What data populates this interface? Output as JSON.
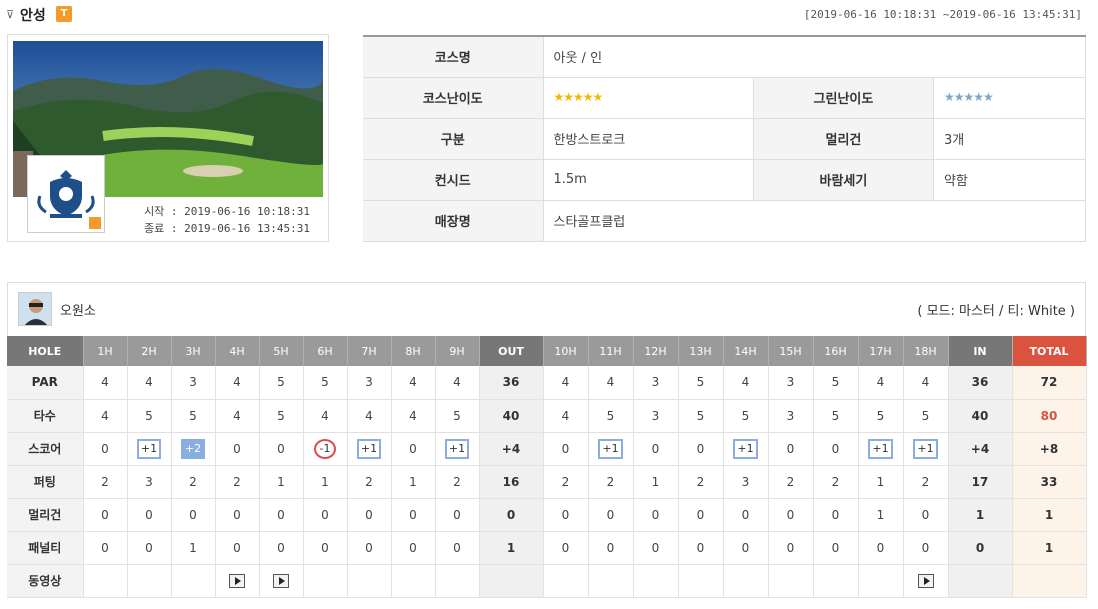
{
  "header": {
    "title": "안성",
    "badge": "T",
    "date_range": "[2019-06-16 10:18:31 ~2019-06-16 13:45:31]"
  },
  "photo": {
    "start_time": "시작 : 2019-06-16 10:18:31",
    "end_time": "종료 : 2019-06-16 13:45:31"
  },
  "info": {
    "course_name_label": "코스명",
    "course_name": "아웃 / 인",
    "course_difficulty_label": "코스난이도",
    "course_difficulty_stars": "★★★★★",
    "green_difficulty_label": "그린난이도",
    "green_difficulty_stars": "★★★★★",
    "type_label": "구분",
    "type": "한방스트로크",
    "mulligan_label": "멀리건",
    "mulligan": "3개",
    "concede_label": "컨시드",
    "concede": "1.5m",
    "wind_label": "바람세기",
    "wind": "약함",
    "store_label": "매장명",
    "store": "스타골프클럽"
  },
  "player": {
    "name": "오원소",
    "mode": "( 모드: 마스터 / 티: White )"
  },
  "scorecard": {
    "headers": [
      "HOLE",
      "1H",
      "2H",
      "3H",
      "4H",
      "5H",
      "6H",
      "7H",
      "8H",
      "9H",
      "OUT",
      "10H",
      "11H",
      "12H",
      "13H",
      "14H",
      "15H",
      "16H",
      "17H",
      "18H",
      "IN",
      "TOTAL"
    ],
    "rows": [
      {
        "label": "PAR",
        "cells": [
          "4",
          "4",
          "3",
          "4",
          "5",
          "5",
          "3",
          "4",
          "4",
          "36",
          "4",
          "4",
          "3",
          "5",
          "4",
          "3",
          "5",
          "4",
          "4",
          "36",
          "72"
        ]
      },
      {
        "label": "타수",
        "cells": [
          "4",
          "5",
          "5",
          "4",
          "5",
          "4",
          "4",
          "4",
          "5",
          "40",
          "4",
          "5",
          "3",
          "5",
          "5",
          "3",
          "5",
          "5",
          "5",
          "40",
          "80"
        ]
      },
      {
        "label": "스코어",
        "cells": [
          "0",
          "+1",
          "+2",
          "0",
          "0",
          "-1",
          "+1",
          "0",
          "+1",
          "+4",
          "0",
          "+1",
          "0",
          "0",
          "+1",
          "0",
          "0",
          "+1",
          "+1",
          "+4",
          "+8"
        ]
      },
      {
        "label": "퍼팅",
        "cells": [
          "2",
          "3",
          "2",
          "2",
          "1",
          "1",
          "2",
          "1",
          "2",
          "16",
          "2",
          "2",
          "1",
          "2",
          "3",
          "2",
          "2",
          "1",
          "2",
          "17",
          "33"
        ]
      },
      {
        "label": "멀리건",
        "cells": [
          "0",
          "0",
          "0",
          "0",
          "0",
          "0",
          "0",
          "0",
          "0",
          "0",
          "0",
          "0",
          "0",
          "0",
          "0",
          "0",
          "0",
          "1",
          "0",
          "1",
          "1"
        ]
      },
      {
        "label": "패널티",
        "cells": [
          "0",
          "0",
          "1",
          "0",
          "0",
          "0",
          "0",
          "0",
          "0",
          "1",
          "0",
          "0",
          "0",
          "0",
          "0",
          "0",
          "0",
          "0",
          "0",
          "0",
          "1"
        ]
      },
      {
        "label": "동영상",
        "cells": [
          "",
          "",
          "",
          "",
          "",
          "",
          "",
          "",
          "",
          "",
          "",
          "",
          "",
          "",
          "",
          "",
          "",
          "",
          "",
          "",
          ""
        ]
      }
    ]
  },
  "colors": {
    "header_gray": "#9a9a9a",
    "total_red": "#d9533f",
    "bogey_blue": "#8aaee0",
    "birdie_red": "#e04b4b",
    "accent_orange": "#f39a2b"
  },
  "icons": {
    "video_holes": [
      "4H",
      "5H",
      "18H"
    ]
  }
}
